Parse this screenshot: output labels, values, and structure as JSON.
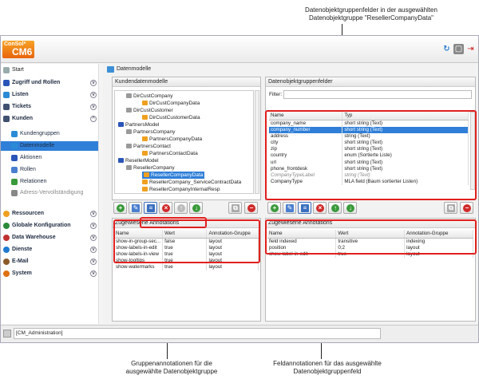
{
  "callouts": {
    "top_line1": "Datenobjektgruppenfelder in der ausgewählten",
    "top_line2": "Datenobjektgruppe \"ResellerCompanyData\"",
    "bottom_left_line1": "Gruppenannotationen für die",
    "bottom_left_line2": "ausgewählte Datenobjektgruppe",
    "bottom_right_line1": "Feldannotationen für das ausgewählte",
    "bottom_right_line2": "Datenobjektgruppenfeld"
  },
  "header": {
    "logo_top": "ConSol*",
    "logo_main": "CM6",
    "refresh_icon": "refresh-icon",
    "window_icon": "window-icon",
    "logout_icon": "logout-icon"
  },
  "sidebar": {
    "start": "Start",
    "items": [
      {
        "label": "Zugriff und Rollen",
        "icon": "key-icon",
        "color": "#2a55b8"
      },
      {
        "label": "Listen",
        "icon": "list-icon",
        "color": "#2a8ad6"
      },
      {
        "label": "Tickets",
        "icon": "ticket-icon",
        "color": "#405070"
      },
      {
        "label": "Kunden",
        "icon": "person-icon",
        "color": "#405070"
      }
    ],
    "sub_items": [
      {
        "label": "Kundengruppen",
        "icon": "group-icon"
      },
      {
        "label": "Datenmodelle",
        "icon": "datamodel-icon"
      },
      {
        "label": "Aktionen",
        "icon": "action-icon"
      },
      {
        "label": "Rollen",
        "icon": "roles-icon"
      },
      {
        "label": "Relationen",
        "icon": "relations-icon"
      },
      {
        "label": "Adress-Vervollständigung",
        "icon": "address-icon"
      }
    ],
    "bottom_items": [
      {
        "label": "Ressourcen",
        "icon": "resources-icon",
        "color": "#f0a020"
      },
      {
        "label": "Globale Konfiguration",
        "icon": "globe-icon",
        "color": "#2a8a3a"
      },
      {
        "label": "Data Warehouse",
        "icon": "warehouse-icon",
        "color": "#c03030"
      },
      {
        "label": "Dienste",
        "icon": "services-icon",
        "color": "#1e7ad0"
      },
      {
        "label": "E-Mail",
        "icon": "mail-icon",
        "color": "#8a5a2a"
      },
      {
        "label": "System",
        "icon": "system-icon",
        "color": "#e07010"
      }
    ]
  },
  "main": {
    "breadcrumb": "Datenmodelle",
    "left_panel_title": "Kundendatenmodelle",
    "right_panel_title": "Datenobjektgruppenfelder",
    "filter_label": "Filter:",
    "tree": [
      {
        "label": "DirCustCompany",
        "indent": 1,
        "color": "#9a9a9a"
      },
      {
        "label": "DirCustCompanyData",
        "indent": 3,
        "color": "#f0a020"
      },
      {
        "label": "DirCustCustomer",
        "indent": 1,
        "color": "#9a9a9a"
      },
      {
        "label": "DirCustCustomerData",
        "indent": 3,
        "color": "#f0a020"
      },
      {
        "label": "PartnersModel",
        "indent": 0,
        "color": "#2a55b8"
      },
      {
        "label": "PartnersCompany",
        "indent": 1,
        "color": "#9a9a9a"
      },
      {
        "label": "PartnersCompanyData",
        "indent": 3,
        "color": "#f0a020"
      },
      {
        "label": "PartnersContact",
        "indent": 1,
        "color": "#9a9a9a"
      },
      {
        "label": "PartnersContactData",
        "indent": 3,
        "color": "#f0a020"
      },
      {
        "label": "ResellerModel",
        "indent": 0,
        "color": "#2a55b8"
      },
      {
        "label": "ResellerCompany",
        "indent": 1,
        "color": "#9a9a9a"
      },
      {
        "label": "ResellerCompanyData",
        "indent": 3,
        "color": "#f0a020",
        "selected": true
      },
      {
        "label": "ResellerCompany_ServiceContractData",
        "indent": 3,
        "color": "#f0a020"
      },
      {
        "label": "ResellerCompanyInternalResp",
        "indent": 3,
        "color": "#f0a020"
      }
    ],
    "fields_table": {
      "headers": [
        "Name",
        "Typ"
      ],
      "rows": [
        {
          "name": "company_name",
          "type": "short string (Text)"
        },
        {
          "name": "company_number",
          "type": "short string (Text)",
          "selected": true
        },
        {
          "name": "address",
          "type": "string (Text)"
        },
        {
          "name": "city",
          "type": "short string (Text)"
        },
        {
          "name": "zip",
          "type": "short string (Text)"
        },
        {
          "name": "country",
          "type": "enum (Sortierte Liste)"
        },
        {
          "name": "url",
          "type": "short string (Text)"
        },
        {
          "name": "phone_frontdesk",
          "type": "short string (Text)"
        },
        {
          "name": "CompanyTypeLabel",
          "type": "string (Text)",
          "italic": true
        },
        {
          "name": "CompanyType",
          "type": "MLA field (Baum sortierter Listen)"
        }
      ]
    },
    "group_annotations": {
      "title": "Zugewiesene Annotations",
      "headers": [
        "Name",
        "Wert",
        "Annotation-Gruppe"
      ],
      "rows": [
        [
          "show-in-group-sec...",
          "false",
          "layout"
        ],
        [
          "show-labels-in-edit",
          "true",
          "layout"
        ],
        [
          "show-labels-in-view",
          "true",
          "layout"
        ],
        [
          "show-tooltips",
          "true",
          "layout"
        ],
        [
          "show-watermarks",
          "true",
          "layout"
        ]
      ]
    },
    "field_annotations": {
      "title": "Zugewiesene Annotations",
      "headers": [
        "Name",
        "Wert",
        "Annotation-Gruppe"
      ],
      "rows": [
        [
          "field indexed",
          "transitive",
          "indexing"
        ],
        [
          "position",
          "0;2",
          "layout"
        ],
        [
          "show-label-in-edit",
          "true",
          "layout"
        ]
      ]
    }
  },
  "status": {
    "user": "[CM_Administration]"
  }
}
